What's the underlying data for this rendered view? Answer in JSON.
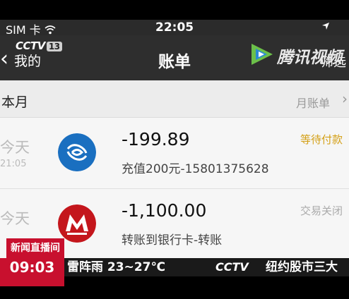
{
  "status_bar": {
    "carrier": "SIM 卡",
    "time": "22:05"
  },
  "nav": {
    "back_label": "我的",
    "title": "账单",
    "filter_label": "筛选"
  },
  "watermark": {
    "channel_logo": "CCTV",
    "channel_number": "13",
    "video_logo": "腾讯视频"
  },
  "section": {
    "title": "本月",
    "month_bill_label": "月账单"
  },
  "transactions": [
    {
      "day": "今天",
      "time": "21:05",
      "amount": "-199.89",
      "description": "充值200元-15801375628",
      "status": "等待付款",
      "brand_color": "#1a6fc0"
    },
    {
      "day": "今天",
      "time": "",
      "amount": "-1,100.00",
      "description": "转账到银行卡-转账",
      "status": "交易关闭",
      "brand_color": "#c4161c"
    }
  ],
  "broadcast": {
    "news_tag": "新闻直播间",
    "clock": "09:03",
    "weather": "雷阵雨 23~27℃",
    "ticker_logo": "CCTV",
    "headline": "纽约股市三大"
  },
  "colors": {
    "accent_red": "#c8102e",
    "pending_yellow": "#d4a017"
  }
}
